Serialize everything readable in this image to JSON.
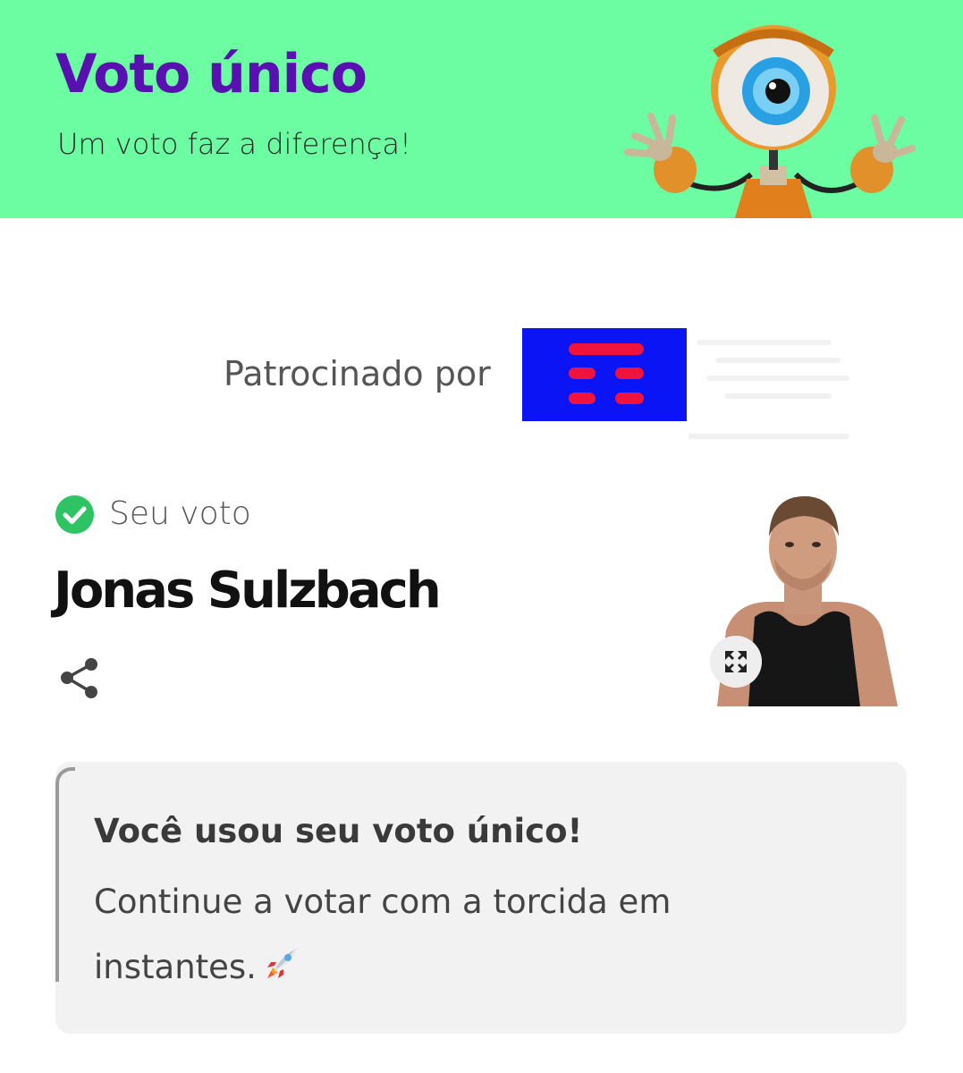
{
  "header": {
    "title": "Voto único",
    "subtitle": "Um voto faz a diferença!",
    "background_color": "#6cfca2",
    "title_color": "#5a0fb0",
    "mascot_icon": "big-brother-eye-mascot"
  },
  "sponsor": {
    "label": "Patrocinado por",
    "logo_icon": "sponsor-logo",
    "logo_color": "#0a14f5"
  },
  "vote": {
    "status_icon": "check-circle-icon",
    "status_label": "Seu voto",
    "candidate_name": "Jonas Sulzbach",
    "share_icon": "share-icon",
    "expand_icon": "expand-icon"
  },
  "info": {
    "title": "Você usou seu voto único!",
    "body": "Continue a votar com a torcida em instantes.",
    "emoji_icon": "rocket-icon"
  }
}
